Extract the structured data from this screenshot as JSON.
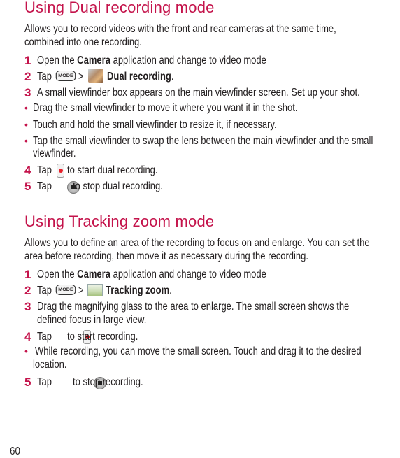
{
  "page_number": "60",
  "colors": {
    "accent": "#c4134b",
    "text": "#231f20"
  },
  "sections": [
    {
      "title": "Using Dual recording mode",
      "intro_lines": [
        "Allows you to record videos with the front and rear cameras at the same time,",
        "combined into one recording."
      ],
      "steps": {
        "s1": {
          "num": "1",
          "pre": "Open the ",
          "bold": "Camera",
          "post": " application and change to video mode"
        },
        "s2": {
          "num": "2",
          "pre": "Tap",
          "mode_label": "MODE",
          "sep": ">",
          "bold": "Dual recording",
          "post": ".",
          "icon": "dual-recording-icon"
        },
        "s3": {
          "num": "3",
          "text": "A small viewfinder box appears on the main viewfinder screen. Set up your shot."
        },
        "b1": "Drag the small viewfinder to move it where you want it in the shot.",
        "b2": "Touch and hold the small viewfinder to resize it, if necessary.",
        "b3a": "Tap the small viewfinder to swap the lens between the main viewfinder and the small",
        "b3b": "viewfinder.",
        "s4": {
          "num": "4",
          "pre": "Tap",
          "post": "to start dual recording."
        },
        "s5": {
          "num": "5",
          "pre": "Tap",
          "post": "to stop dual recording."
        }
      }
    },
    {
      "title": "Using Tracking zoom mode",
      "intro_lines": [
        "Allows you to define an area of the recording to focus on and enlarge. You can set the",
        "area before recording, then move it as necessary during the recording."
      ],
      "steps": {
        "s1": {
          "num": "1",
          "pre": "Open the ",
          "bold": "Camera",
          "post": " application and change to video mode"
        },
        "s2": {
          "num": "2",
          "pre": "Tap",
          "mode_label": "MODE",
          "sep": ">",
          "bold": "Tracking zoom",
          "post": ".",
          "icon": "tracking-zoom-icon"
        },
        "s3a": {
          "num": "3",
          "text": "Drag the magnifying glass to the area to enlarge. The small screen shows the"
        },
        "s3b": "defined focus in large view.",
        "s4": {
          "num": "4",
          "pre": "Tap",
          "post": "to start recording."
        },
        "b1a": "While recording, you can move the small screen. Touch and drag it to the desired",
        "b1b": "location.",
        "s5": {
          "num": "5",
          "pre": "Tap",
          "post": "to stop recording."
        }
      }
    }
  ],
  "bullet_glyph": "•"
}
